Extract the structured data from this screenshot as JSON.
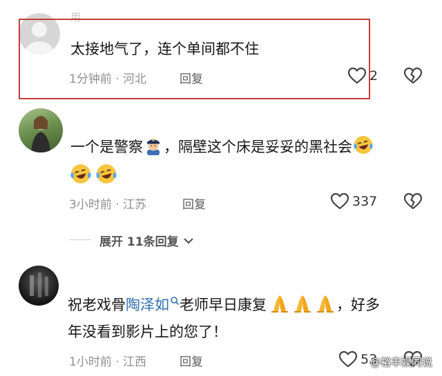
{
  "comments": [
    {
      "username": "用",
      "text": "太接地气了，连个单间都不住",
      "time": "1分钟前",
      "location": "河北",
      "reply_label": "回复",
      "like_count": "2"
    },
    {
      "username": "",
      "text_part1": "一个是警察",
      "text_part2": "，隔壁这个床是妥妥的黑社会",
      "time": "3小时前",
      "location": "江苏",
      "reply_label": "回复",
      "like_count": "337",
      "expand_label": "展开 11条回复"
    },
    {
      "username": "",
      "text_part1": "祝老戏骨",
      "mention": "陶泽如",
      "text_part2": "老师早日康复",
      "text_part3": "，好多",
      "text_line2": "年没看到影片上的您了！",
      "time": "1小时前",
      "location": "江西",
      "reply_label": "回复",
      "like_count": "53"
    }
  ],
  "separator": "·",
  "watermark": "@裕丰娱同说",
  "icons": [
    "heart-icon",
    "broken-heart-icon",
    "police-emoji",
    "laughing-emoji",
    "pray-emoji",
    "search-icon",
    "chevron-down-icon"
  ],
  "colors": {
    "highlight_border": "#c73a3a",
    "mention": "#2f6fb1",
    "meta": "#8f8f8f"
  }
}
